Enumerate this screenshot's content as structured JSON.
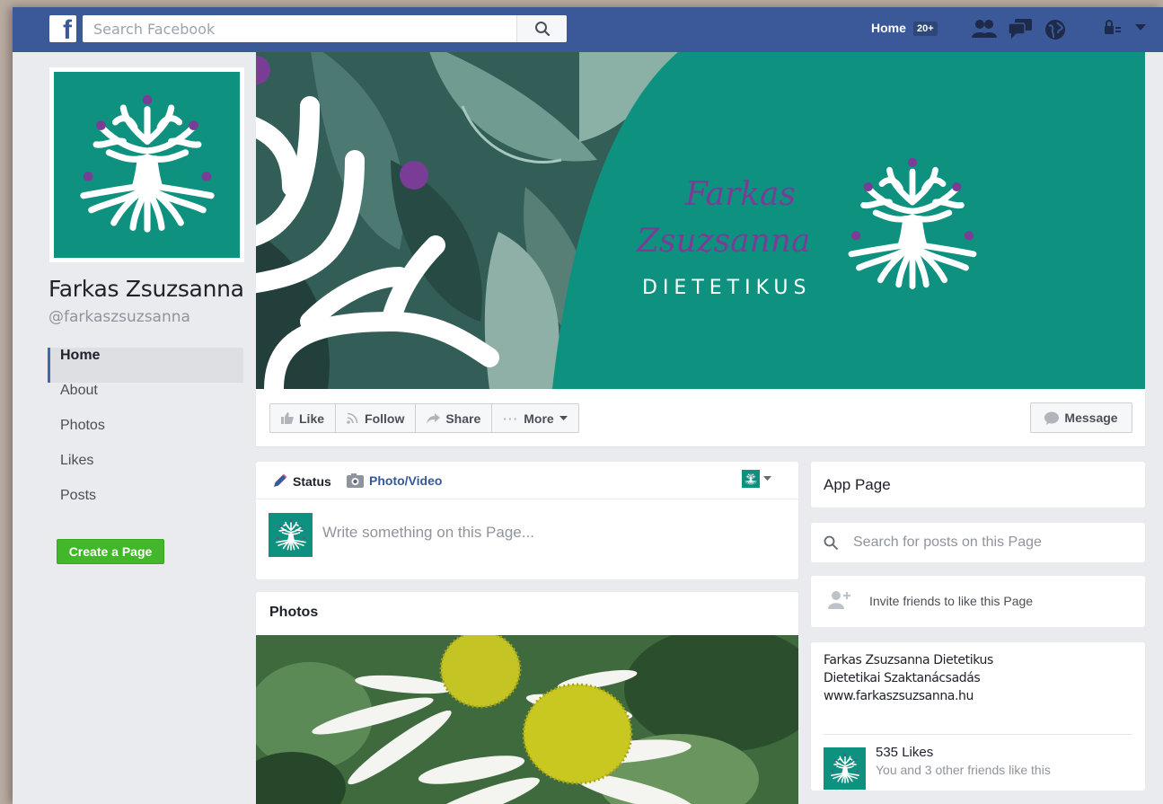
{
  "topbar": {
    "logo": "f",
    "search_placeholder": "Search Facebook",
    "home_label": "Home",
    "home_badge": "20+",
    "icons": [
      "search-icon",
      "friend-requests-icon",
      "messages-icon",
      "notifications-globe-icon",
      "privacy-lock-icon",
      "account-menu-icon"
    ]
  },
  "profile": {
    "name": "Farkas Zsuzsanna",
    "handle": "@farkaszsuzsanna"
  },
  "side_nav": [
    {
      "label": "Home",
      "active": true
    },
    {
      "label": "About"
    },
    {
      "label": "Photos"
    },
    {
      "label": "Likes"
    },
    {
      "label": "Posts"
    }
  ],
  "create_page_label": "Create a Page",
  "cover": {
    "script_line1": "Farkas",
    "script_line2": "Zsuzsanna",
    "tagline": "DIETETIKUS"
  },
  "actions": {
    "like": "Like",
    "follow": "Follow",
    "share": "Share",
    "more": "More",
    "message": "Message"
  },
  "composer": {
    "status_tab": "Status",
    "photo_tab": "Photo/Video",
    "placeholder": "Write something on this Page..."
  },
  "photos": {
    "title": "Photos"
  },
  "right": {
    "app_page": "App Page",
    "search_placeholder": "Search for posts on this Page",
    "invite": "Invite friends to like this Page",
    "about_lines": [
      "Farkas Zsuzsanna Dietetikus",
      "Dietetikai Szaktanácsadás",
      "www.farkaszsuzsanna.hu"
    ],
    "likes_count": "535 Likes",
    "likes_sub": "You and 3 other friends like this"
  },
  "colors": {
    "facebook_blue": "#3b5998",
    "brand_teal": "#0f9180",
    "brand_purple": "#7a3d96",
    "create_green": "#42b72a"
  }
}
